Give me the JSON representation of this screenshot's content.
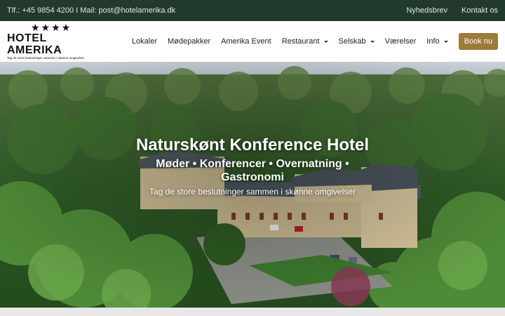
{
  "topbar": {
    "contact": "Tlf.: +45 9854 4200 I Mail: post@hotelamerika.dk",
    "links": [
      "Nyhedsbrev",
      "Kontakt os"
    ]
  },
  "logo": {
    "stars": "★★★★",
    "name": "HOTEL AMERIKA",
    "tagline": "Tag de store beslutninger sammen i skønne omgivelser"
  },
  "nav": {
    "items": [
      {
        "label": "Lokaler"
      },
      {
        "label": "Mødepakker"
      },
      {
        "label": "Amerika Event"
      },
      {
        "label": "Restaurant"
      },
      {
        "label": "Selskab"
      },
      {
        "label": "Værelser"
      },
      {
        "label": "Info"
      }
    ],
    "book_label": "Book nu"
  },
  "hero": {
    "title": "Naturskønt Konference Hotel",
    "subtitle": "Møder • Konferencer • Overnatning • Gastronomi",
    "tagline": "Tag de store beslutninger sammen i skønne omgivelser"
  },
  "colors": {
    "topbar_bg": "#223a2b",
    "accent": "#9c7a38"
  }
}
